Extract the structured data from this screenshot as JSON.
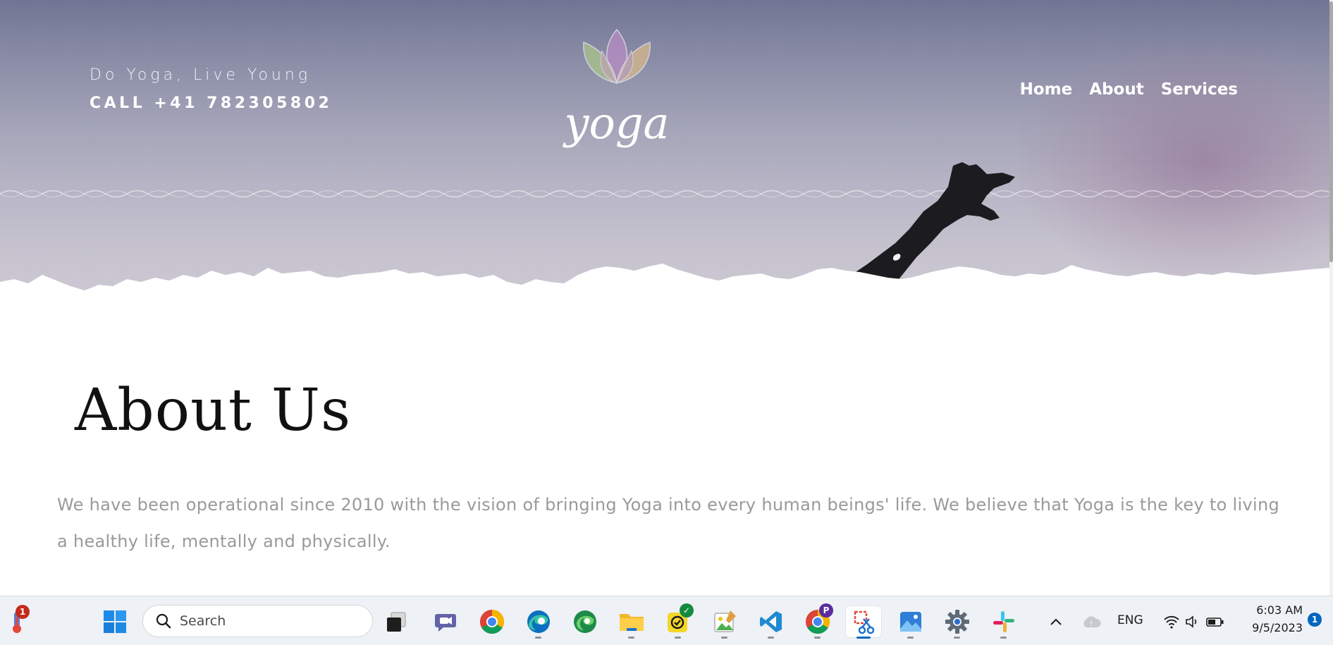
{
  "header": {
    "tagline": "Do Yoga, Live Young",
    "phone": "CALL +41 782305802",
    "logo_text": "yoga",
    "nav": [
      {
        "label": "Home"
      },
      {
        "label": "About"
      },
      {
        "label": "Services"
      }
    ]
  },
  "about": {
    "title": "About Us",
    "body": "We have been operational since 2010 with the vision of bringing Yoga into every human beings' life. We believe that Yoga is the key to living a healthy life, mentally and physically."
  },
  "taskbar": {
    "search_placeholder": "Search",
    "weather_badge": "1",
    "chrome_profile_badge": "P",
    "language": "ENG",
    "time": "6:03 AM",
    "date": "9/5/2023",
    "notification_count": "1",
    "apps": [
      {
        "name": "weather-widget-icon"
      },
      {
        "name": "windows-start-icon"
      },
      {
        "name": "task-view-icon"
      },
      {
        "name": "teams-chat-icon"
      },
      {
        "name": "chrome-icon"
      },
      {
        "name": "edge-icon"
      },
      {
        "name": "edge-beta-icon"
      },
      {
        "name": "file-explorer-icon"
      },
      {
        "name": "todo-icon"
      },
      {
        "name": "paint-icon"
      },
      {
        "name": "vscode-icon"
      },
      {
        "name": "chrome-profile-icon"
      },
      {
        "name": "snipping-tool-icon"
      },
      {
        "name": "photos-icon"
      },
      {
        "name": "settings-icon"
      },
      {
        "name": "slack-icon"
      }
    ]
  },
  "colors": {
    "hero_top": "#6d7190",
    "hero_bottom": "#cbc7d2",
    "body_text": "#9a9a9a",
    "title_text": "#111111",
    "accent_blue": "#0067c0"
  }
}
